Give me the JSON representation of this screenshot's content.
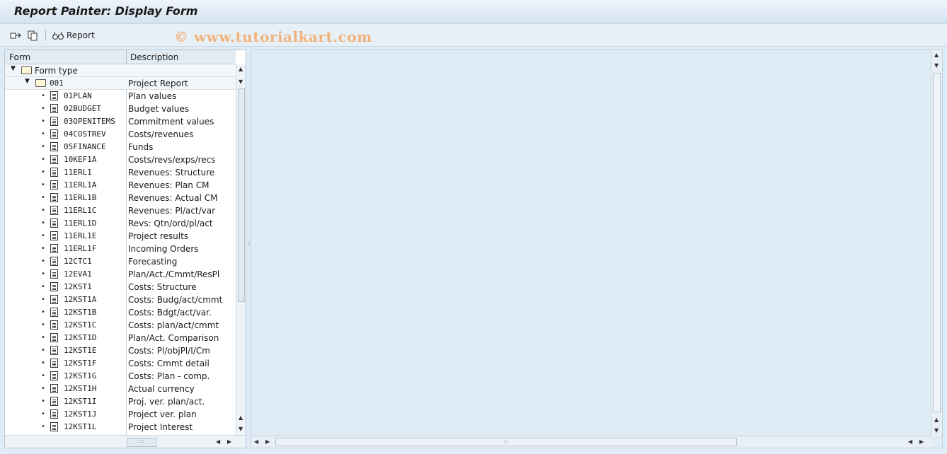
{
  "window": {
    "title": "Report Painter: Display Form"
  },
  "toolbar": {
    "report_label": "Report"
  },
  "watermark": "© www.tutorialkart.com",
  "tree": {
    "columns": {
      "form": "Form",
      "description": "Description"
    },
    "root": {
      "label": "Form type"
    },
    "group": {
      "label": "001",
      "description": "Project Report"
    },
    "items": [
      {
        "form": "01PLAN",
        "description": "Plan values"
      },
      {
        "form": "02BUDGET",
        "description": "Budget values"
      },
      {
        "form": "03OPENITEMS",
        "description": "Commitment values"
      },
      {
        "form": "04COSTREV",
        "description": "Costs/revenues"
      },
      {
        "form": "05FINANCE",
        "description": "Funds"
      },
      {
        "form": "10KEF1A",
        "description": "Costs/revs/exps/recs"
      },
      {
        "form": "11ERL1",
        "description": "Revenues: Structure"
      },
      {
        "form": "11ERL1A",
        "description": "Revenues: Plan CM"
      },
      {
        "form": "11ERL1B",
        "description": "Revenues: Actual CM"
      },
      {
        "form": "11ERL1C",
        "description": "Revenues: Pl/act/var"
      },
      {
        "form": "11ERL1D",
        "description": "Revs: Qtn/ord/pl/act"
      },
      {
        "form": "11ERL1E",
        "description": "Project results"
      },
      {
        "form": "11ERL1F",
        "description": "Incoming Orders"
      },
      {
        "form": "12CTC1",
        "description": "Forecasting"
      },
      {
        "form": "12EVA1",
        "description": "Plan/Act./Cmmt/ResPl"
      },
      {
        "form": "12KST1",
        "description": "Costs: Structure"
      },
      {
        "form": "12KST1A",
        "description": "Costs: Budg/act/cmmt"
      },
      {
        "form": "12KST1B",
        "description": "Costs: Bdgt/act/var."
      },
      {
        "form": "12KST1C",
        "description": "Costs: plan/act/cmmt"
      },
      {
        "form": "12KST1D",
        "description": "Plan/Act. Comparison"
      },
      {
        "form": "12KST1E",
        "description": "Costs: Pl/objPl/I/Cm"
      },
      {
        "form": "12KST1F",
        "description": "Costs: Cmmt detail"
      },
      {
        "form": "12KST1G",
        "description": "Costs: Plan - comp."
      },
      {
        "form": "12KST1H",
        "description": "Actual currency"
      },
      {
        "form": "12KST1I",
        "description": "Proj. ver. plan/act."
      },
      {
        "form": "12KST1J",
        "description": "Project ver. plan"
      },
      {
        "form": "12KST1L",
        "description": "Project Interest"
      }
    ]
  }
}
